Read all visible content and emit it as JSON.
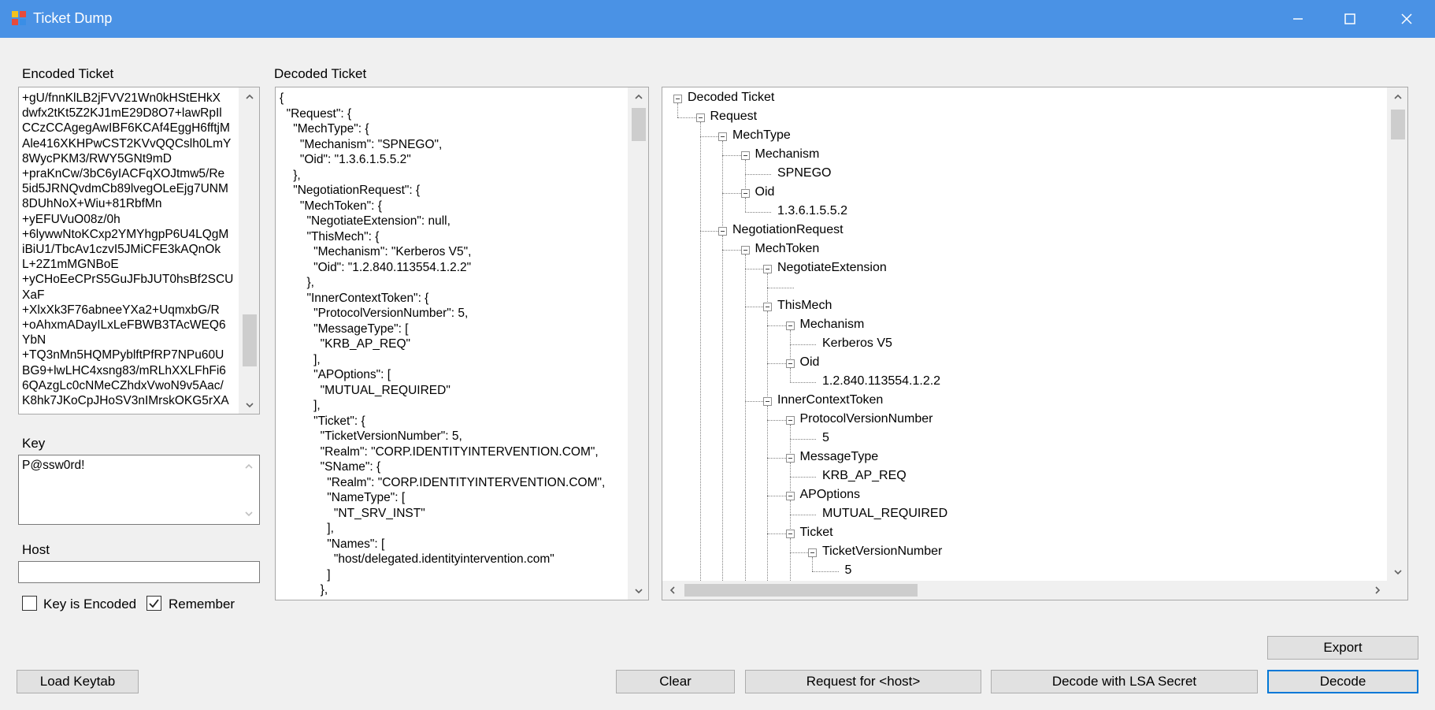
{
  "window": {
    "title": "Ticket Dump"
  },
  "labels": {
    "encoded_ticket": "Encoded Ticket",
    "decoded_ticket": "Decoded Ticket",
    "key": "Key",
    "host": "Host"
  },
  "encoded_ticket_lines": [
    "+gU/fnnKlLB2jFVV21Wn0kHStEHkX",
    "dwfx2tKt5Z2KJ1mE29D8O7+lawRpIl",
    "CCzCCAgegAwIBF6KCAf4EggH6fftjM",
    "Ale416XKHPwCST2KVvQQCslh0LmY",
    "8WycPKM3/RWY5GNt9mD",
    "+praKnCw/3bC6yIACFqXOJtmw5/Re",
    "5id5JRNQvdmCb89lvegOLeEjg7UNM",
    "8DUhNoX+Wiu+81RbfMn",
    "+yEFUVuO08z/0h",
    "+6lywwNtoKCxp2YMYhgpP6U4LQgM",
    "iBiU1/TbcAv1czvI5JMiCFE3kAQnOk",
    "L+2Z1mMGNBoE",
    "+yCHoEeCPrS5GuJFbJUT0hsBf2SCU",
    "XaF",
    "+XlxXk3F76abneeYXa2+UqmxbG/R",
    "+oAhxmADayILxLeFBWB3TAcWEQ6",
    "YbN",
    "+TQ3nMn5HQMPyblftPfRP7NPu60U",
    "BG9+lwLHC4xsng83/mRLhXXLFhFi6",
    "6QAzgLc0cNMeCZhdxVwoN9v5Aac/",
    "K8hk7JKoCpJHoSV3nIMrskOKG5rXA"
  ],
  "key_value": "P@ssw0rd!",
  "host_value": "",
  "decoded_json_lines": [
    "{",
    "  \"Request\": {",
    "    \"MechType\": {",
    "      \"Mechanism\": \"SPNEGO\",",
    "      \"Oid\": \"1.3.6.1.5.5.2\"",
    "    },",
    "    \"NegotiationRequest\": {",
    "      \"MechToken\": {",
    "        \"NegotiateExtension\": null,",
    "        \"ThisMech\": {",
    "          \"Mechanism\": \"Kerberos V5\",",
    "          \"Oid\": \"1.2.840.113554.1.2.2\"",
    "        },",
    "        \"InnerContextToken\": {",
    "          \"ProtocolVersionNumber\": 5,",
    "          \"MessageType\": [",
    "            \"KRB_AP_REQ\"",
    "          ],",
    "          \"APOptions\": [",
    "            \"MUTUAL_REQUIRED\"",
    "          ],",
    "          \"Ticket\": {",
    "            \"TicketVersionNumber\": 5,",
    "            \"Realm\": \"CORP.IDENTITYINTERVENTION.COM\",",
    "            \"SName\": {",
    "              \"Realm\": \"CORP.IDENTITYINTERVENTION.COM\",",
    "              \"NameType\": [",
    "                \"NT_SRV_INST\"",
    "              ],",
    "              \"Names\": [",
    "                \"host/delegated.identityintervention.com\"",
    "              ]",
    "            },"
  ],
  "tree": [
    {
      "label": "Decoded Ticket",
      "depth": 0,
      "expander": true
    },
    {
      "label": "Request",
      "depth": 1,
      "expander": true
    },
    {
      "label": "MechType",
      "depth": 2,
      "expander": true
    },
    {
      "label": "Mechanism",
      "depth": 3,
      "expander": true
    },
    {
      "label": "SPNEGO",
      "depth": 4,
      "expander": false
    },
    {
      "label": "Oid",
      "depth": 3,
      "expander": true
    },
    {
      "label": "1.3.6.1.5.5.2",
      "depth": 4,
      "expander": false
    },
    {
      "label": "NegotiationRequest",
      "depth": 2,
      "expander": true
    },
    {
      "label": "MechToken",
      "depth": 3,
      "expander": true
    },
    {
      "label": "NegotiateExtension",
      "depth": 4,
      "expander": true
    },
    {
      "label": "",
      "depth": 5,
      "expander": false
    },
    {
      "label": "ThisMech",
      "depth": 4,
      "expander": true
    },
    {
      "label": "Mechanism",
      "depth": 5,
      "expander": true
    },
    {
      "label": "Kerberos V5",
      "depth": 6,
      "expander": false
    },
    {
      "label": "Oid",
      "depth": 5,
      "expander": true
    },
    {
      "label": "1.2.840.113554.1.2.2",
      "depth": 6,
      "expander": false
    },
    {
      "label": "InnerContextToken",
      "depth": 4,
      "expander": true
    },
    {
      "label": "ProtocolVersionNumber",
      "depth": 5,
      "expander": true
    },
    {
      "label": "5",
      "depth": 6,
      "expander": false
    },
    {
      "label": "MessageType",
      "depth": 5,
      "expander": true
    },
    {
      "label": "KRB_AP_REQ",
      "depth": 6,
      "expander": false
    },
    {
      "label": "APOptions",
      "depth": 5,
      "expander": true
    },
    {
      "label": "MUTUAL_REQUIRED",
      "depth": 6,
      "expander": false
    },
    {
      "label": "Ticket",
      "depth": 5,
      "expander": true
    },
    {
      "label": "TicketVersionNumber",
      "depth": 6,
      "expander": true
    },
    {
      "label": "5",
      "depth": 7,
      "expander": false
    }
  ],
  "checkboxes": {
    "key_is_encoded": {
      "label": "Key is Encoded",
      "checked": false
    },
    "remember": {
      "label": "Remember",
      "checked": true
    }
  },
  "buttons": {
    "load_keytab": "Load Keytab",
    "clear": "Clear",
    "request_for_host": "Request for <host>",
    "decode_with_lsa": "Decode with LSA Secret",
    "decode": "Decode",
    "export": "Export"
  }
}
